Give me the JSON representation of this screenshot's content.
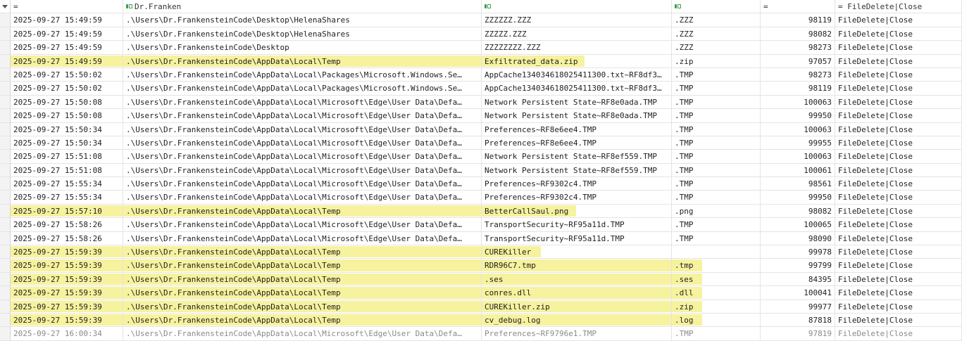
{
  "filter_row": {
    "time": "=",
    "path": "Dr.Franken",
    "name": "",
    "ext": "",
    "size": "=",
    "reason": "= FileDelete|Close"
  },
  "icons": {
    "filter": "filter-icon",
    "text_filter": "regex-filter-icon"
  },
  "colors": {
    "highlight": "#f6f29e",
    "filter_icon_green": "#3a9d4d"
  },
  "rows": [
    {
      "time": "2025-09-27 15:49:59",
      "path": ".\\Users\\Dr.FrankensteinCode\\Desktop\\HelenaShares",
      "name": "ZZZZZZ.ZZZ",
      "ext": ".ZZZ",
      "size": "98119",
      "reason": "FileDelete|Close",
      "hl": {}
    },
    {
      "time": "2025-09-27 15:49:59",
      "path": ".\\Users\\Dr.FrankensteinCode\\Desktop\\HelenaShares",
      "name": "ZZZZZ.ZZZ",
      "ext": ".ZZZ",
      "size": "98082",
      "reason": "FileDelete|Close",
      "hl": {}
    },
    {
      "time": "2025-09-27 15:49:59",
      "path": ".\\Users\\Dr.FrankensteinCode\\Desktop",
      "name": "ZZZZZZZZ.ZZZ",
      "ext": ".ZZZ",
      "size": "98273",
      "reason": "FileDelete|Close",
      "hl": {}
    },
    {
      "time": "2025-09-27 15:49:59",
      "path": ".\\Users\\Dr.FrankensteinCode\\AppData\\Local\\Temp",
      "name": "Exfiltrated_data.zip",
      "ext": ".zip",
      "size": "97057",
      "reason": "FileDelete|Close",
      "hl": {
        "time": 160,
        "path": 508,
        "name": 146
      }
    },
    {
      "time": "2025-09-27 15:50:02",
      "path": ".\\Users\\Dr.FrankensteinCode\\AppData\\Local\\Packages\\Microsoft.Windows.Se…",
      "name": "AppCache134034618025411300.txt~RF8df3…",
      "ext": ".TMP",
      "size": "98273",
      "reason": "FileDelete|Close",
      "hl": {}
    },
    {
      "time": "2025-09-27 15:50:02",
      "path": ".\\Users\\Dr.FrankensteinCode\\AppData\\Local\\Packages\\Microsoft.Windows.Se…",
      "name": "AppCache134034618025411300.txt~RF8df3…",
      "ext": ".TMP",
      "size": "98119",
      "reason": "FileDelete|Close",
      "hl": {}
    },
    {
      "time": "2025-09-27 15:50:08",
      "path": ".\\Users\\Dr.FrankensteinCode\\AppData\\Local\\Microsoft\\Edge\\User Data\\Defa…",
      "name": "Network Persistent State~RF8e0ada.TMP",
      "ext": ".TMP",
      "size": "100063",
      "reason": "FileDelete|Close",
      "hl": {}
    },
    {
      "time": "2025-09-27 15:50:08",
      "path": ".\\Users\\Dr.FrankensteinCode\\AppData\\Local\\Microsoft\\Edge\\User Data\\Defa…",
      "name": "Network Persistent State~RF8e0ada.TMP",
      "ext": ".TMP",
      "size": "99950",
      "reason": "FileDelete|Close",
      "hl": {}
    },
    {
      "time": "2025-09-27 15:50:34",
      "path": ".\\Users\\Dr.FrankensteinCode\\AppData\\Local\\Microsoft\\Edge\\User Data\\Defa…",
      "name": "Preferences~RF8e6ee4.TMP",
      "ext": ".TMP",
      "size": "100063",
      "reason": "FileDelete|Close",
      "hl": {}
    },
    {
      "time": "2025-09-27 15:50:34",
      "path": ".\\Users\\Dr.FrankensteinCode\\AppData\\Local\\Microsoft\\Edge\\User Data\\Defa…",
      "name": "Preferences~RF8e6ee4.TMP",
      "ext": ".TMP",
      "size": "99955",
      "reason": "FileDelete|Close",
      "hl": {}
    },
    {
      "time": "2025-09-27 15:51:08",
      "path": ".\\Users\\Dr.FrankensteinCode\\AppData\\Local\\Microsoft\\Edge\\User Data\\Defa…",
      "name": "Network Persistent State~RF8ef559.TMP",
      "ext": ".TMP",
      "size": "100063",
      "reason": "FileDelete|Close",
      "hl": {}
    },
    {
      "time": "2025-09-27 15:51:08",
      "path": ".\\Users\\Dr.FrankensteinCode\\AppData\\Local\\Microsoft\\Edge\\User Data\\Defa…",
      "name": "Network Persistent State~RF8ef559.TMP",
      "ext": ".TMP",
      "size": "100061",
      "reason": "FileDelete|Close",
      "hl": {}
    },
    {
      "time": "2025-09-27 15:55:34",
      "path": ".\\Users\\Dr.FrankensteinCode\\AppData\\Local\\Microsoft\\Edge\\User Data\\Defa…",
      "name": "Preferences~RF9302c4.TMP",
      "ext": ".TMP",
      "size": "98561",
      "reason": "FileDelete|Close",
      "hl": {}
    },
    {
      "time": "2025-09-27 15:55:34",
      "path": ".\\Users\\Dr.FrankensteinCode\\AppData\\Local\\Microsoft\\Edge\\User Data\\Defa…",
      "name": "Preferences~RF9302c4.TMP",
      "ext": ".TMP",
      "size": "99950",
      "reason": "FileDelete|Close",
      "hl": {}
    },
    {
      "time": "2025-09-27 15:57:10",
      "path": ".\\Users\\Dr.FrankensteinCode\\AppData\\Local\\Temp",
      "name": "BetterCallSaul.png",
      "ext": ".png",
      "size": "98082",
      "reason": "FileDelete|Close",
      "hl": {
        "time": 160,
        "path": 508,
        "name": 134
      }
    },
    {
      "time": "2025-09-27 15:58:26",
      "path": ".\\Users\\Dr.FrankensteinCode\\AppData\\Local\\Microsoft\\Edge\\User Data\\Defa…",
      "name": "TransportSecurity~RF95a11d.TMP",
      "ext": ".TMP",
      "size": "100065",
      "reason": "FileDelete|Close",
      "hl": {}
    },
    {
      "time": "2025-09-27 15:58:26",
      "path": ".\\Users\\Dr.FrankensteinCode\\AppData\\Local\\Microsoft\\Edge\\User Data\\Defa…",
      "name": "TransportSecurity~RF95a11d.TMP",
      "ext": ".TMP",
      "size": "98090",
      "reason": "FileDelete|Close",
      "hl": {}
    },
    {
      "time": "2025-09-27 15:59:39",
      "path": ".\\Users\\Dr.FrankensteinCode\\AppData\\Local\\Temp",
      "name": "CUREKiller",
      "ext": "",
      "size": "99978",
      "reason": "FileDelete|Close",
      "hl": {
        "time": 160,
        "path": 508,
        "name": 84
      }
    },
    {
      "time": "2025-09-27 15:59:39",
      "path": ".\\Users\\Dr.FrankensteinCode\\AppData\\Local\\Temp",
      "name": "RDR96C7.tmp",
      "ext": ".tmp",
      "size": "99799",
      "reason": "FileDelete|Close",
      "hl": {
        "time": 160,
        "path": 508,
        "name": 270,
        "ext": 43
      }
    },
    {
      "time": "2025-09-27 15:59:39",
      "path": ".\\Users\\Dr.FrankensteinCode\\AppData\\Local\\Temp",
      "name": ".ses",
      "ext": ".ses",
      "size": "84395",
      "reason": "FileDelete|Close",
      "hl": {
        "time": 160,
        "path": 508,
        "name": 270,
        "ext": 43
      }
    },
    {
      "time": "2025-09-27 15:59:39",
      "path": ".\\Users\\Dr.FrankensteinCode\\AppData\\Local\\Temp",
      "name": "conres.dll",
      "ext": ".dll",
      "size": "100041",
      "reason": "FileDelete|Close",
      "hl": {
        "time": 160,
        "path": 508,
        "name": 270,
        "ext": 43
      }
    },
    {
      "time": "2025-09-27 15:59:39",
      "path": ".\\Users\\Dr.FrankensteinCode\\AppData\\Local\\Temp",
      "name": "CUREKiller.zip",
      "ext": ".zip",
      "size": "99977",
      "reason": "FileDelete|Close",
      "hl": {
        "time": 160,
        "path": 508,
        "name": 270,
        "ext": 43
      }
    },
    {
      "time": "2025-09-27 15:59:39",
      "path": ".\\Users\\Dr.FrankensteinCode\\AppData\\Local\\Temp",
      "name": "cv_debug.log",
      "ext": ".log",
      "size": "87818",
      "reason": "FileDelete|Close",
      "hl": {
        "time": 160,
        "path": 508,
        "name": 270,
        "ext": 43
      }
    },
    {
      "time": "2025-09-27 16:00:34",
      "path": ".\\Users\\Dr.FrankensteinCode\\AppData\\Local\\Microsoft\\Edge\\User Data\\Defa…",
      "name": "Preferences~RF9796e1.TMP",
      "ext": ".TMP",
      "size": "97819",
      "reason": "FileDelete|Close",
      "hl": {},
      "cut": true
    }
  ]
}
